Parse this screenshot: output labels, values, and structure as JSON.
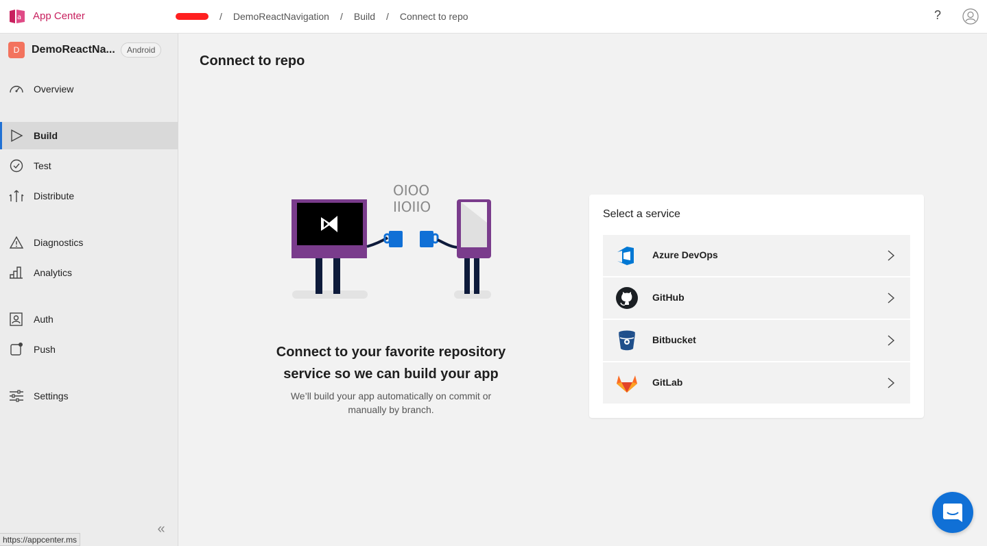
{
  "header": {
    "app_title": "App Center",
    "breadcrumbs": [
      "DemoReactNavigation",
      "Build",
      "Connect to repo"
    ],
    "separator": "/",
    "help_label": "?"
  },
  "sidebar": {
    "app_initial": "D",
    "app_name": "DemoReactNa...",
    "platform": "Android",
    "items": [
      {
        "label": "Overview",
        "icon": "gauge-icon"
      },
      {
        "label": "Build",
        "icon": "play-icon",
        "active": true
      },
      {
        "label": "Test",
        "icon": "check-circle-icon"
      },
      {
        "label": "Distribute",
        "icon": "distribute-icon"
      },
      {
        "label": "Diagnostics",
        "icon": "warning-icon"
      },
      {
        "label": "Analytics",
        "icon": "bar-chart-icon"
      },
      {
        "label": "Auth",
        "icon": "id-card-icon"
      },
      {
        "label": "Push",
        "icon": "push-icon"
      },
      {
        "label": "Settings",
        "icon": "sliders-icon"
      }
    ],
    "collapse_glyph": "«",
    "status_url": "https://appcenter.ms"
  },
  "main": {
    "title": "Connect to repo",
    "illustration_binary_1": "OIOO",
    "illustration_binary_2": "IIOIIO",
    "headline": "Connect to your favorite repository service so we can build your app",
    "subtext": "We’ll build your app automatically on commit or manually by branch."
  },
  "service_card": {
    "title": "Select a service",
    "services": [
      {
        "label": "Azure DevOps",
        "icon": "azure-devops-icon"
      },
      {
        "label": "GitHub",
        "icon": "github-icon"
      },
      {
        "label": "Bitbucket",
        "icon": "bitbucket-icon"
      },
      {
        "label": "GitLab",
        "icon": "gitlab-icon"
      }
    ]
  },
  "colors": {
    "brand": "#c8205e",
    "accent": "#2171d4",
    "chat": "#1070d6"
  }
}
